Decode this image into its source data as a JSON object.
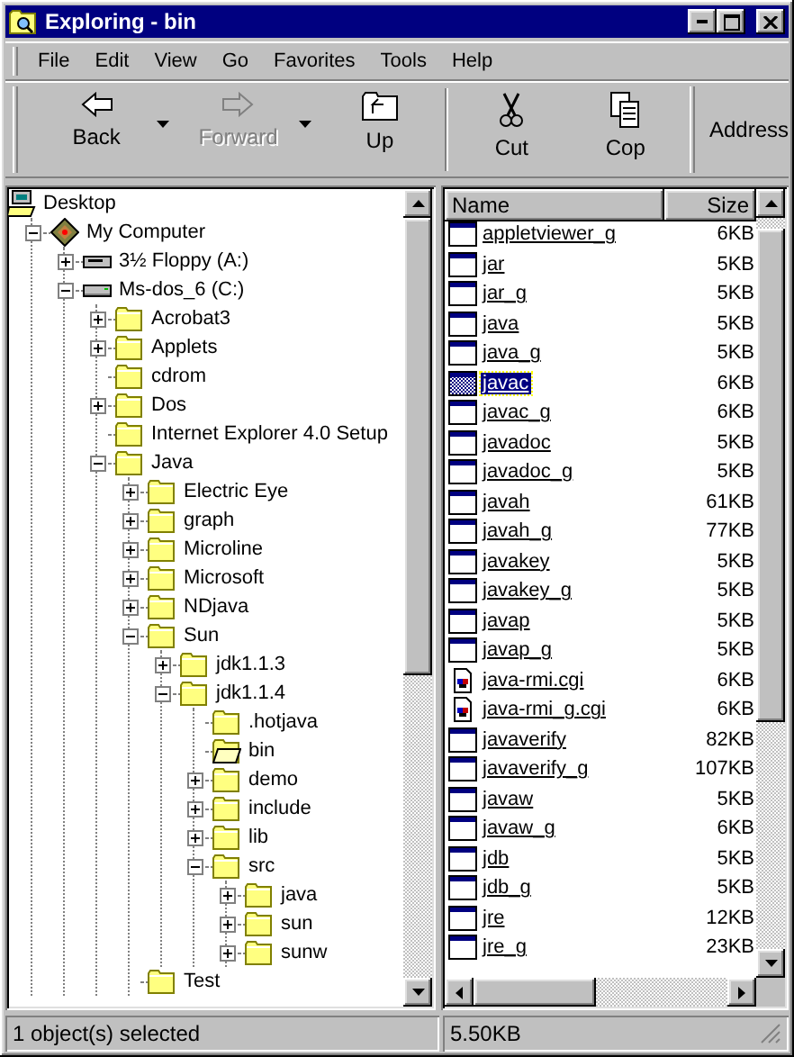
{
  "window": {
    "title": "Exploring - bin"
  },
  "menu": [
    "File",
    "Edit",
    "View",
    "Go",
    "Favorites",
    "Tools",
    "Help"
  ],
  "toolbar": {
    "buttons": [
      {
        "label": "Back",
        "kind": "back",
        "disabled": false,
        "dropdown": true,
        "separator_before": false
      },
      {
        "label": "Forward",
        "kind": "forward",
        "disabled": true,
        "dropdown": true,
        "separator_before": false
      },
      {
        "label": "Up",
        "kind": "up",
        "disabled": false,
        "dropdown": false,
        "separator_before": false
      },
      {
        "label": "Cut",
        "kind": "cut",
        "disabled": false,
        "dropdown": false,
        "separator_before": true
      },
      {
        "label": "Cop",
        "kind": "copy",
        "disabled": false,
        "dropdown": false,
        "separator_before": false
      }
    ],
    "address_label": "Address"
  },
  "folder_tree": {
    "label": "Desktop",
    "kind": "desktop",
    "children": [
      {
        "label": "My Computer",
        "kind": "computer",
        "expanded": true,
        "children": [
          {
            "label": "3½ Floppy (A:)",
            "kind": "floppy",
            "expanded": false
          },
          {
            "label": "Ms-dos_6 (C:)",
            "kind": "drive",
            "expanded": true,
            "children": [
              {
                "label": "Acrobat3",
                "kind": "folder",
                "expanded": false
              },
              {
                "label": "Applets",
                "kind": "folder",
                "expanded": false
              },
              {
                "label": "cdrom",
                "kind": "folder"
              },
              {
                "label": "Dos",
                "kind": "folder",
                "expanded": false
              },
              {
                "label": "Internet Explorer 4.0 Setup",
                "kind": "folder"
              },
              {
                "label": "Java",
                "kind": "folder",
                "expanded": true,
                "children": [
                  {
                    "label": "Electric Eye",
                    "kind": "folder",
                    "expanded": false
                  },
                  {
                    "label": "graph",
                    "kind": "folder",
                    "expanded": false
                  },
                  {
                    "label": "Microline",
                    "kind": "folder",
                    "expanded": false
                  },
                  {
                    "label": "Microsoft",
                    "kind": "folder",
                    "expanded": false
                  },
                  {
                    "label": "NDjava",
                    "kind": "folder",
                    "expanded": false
                  },
                  {
                    "label": "Sun",
                    "kind": "folder",
                    "expanded": true,
                    "children": [
                      {
                        "label": "jdk1.1.3",
                        "kind": "folder",
                        "expanded": false
                      },
                      {
                        "label": "jdk1.1.4",
                        "kind": "folder",
                        "expanded": true,
                        "children": [
                          {
                            "label": ".hotjava",
                            "kind": "folder"
                          },
                          {
                            "label": "bin",
                            "kind": "open-folder"
                          },
                          {
                            "label": "demo",
                            "kind": "folder",
                            "expanded": false
                          },
                          {
                            "label": "include",
                            "kind": "folder",
                            "expanded": false
                          },
                          {
                            "label": "lib",
                            "kind": "folder",
                            "expanded": false
                          },
                          {
                            "label": "src",
                            "kind": "folder",
                            "expanded": true,
                            "children": [
                              {
                                "label": "java",
                                "kind": "folder",
                                "expanded": false
                              },
                              {
                                "label": "sun",
                                "kind": "folder",
                                "expanded": false
                              },
                              {
                                "label": "sunw",
                                "kind": "folder",
                                "expanded": false
                              }
                            ]
                          }
                        ]
                      }
                    ]
                  },
                  {
                    "label": "Test",
                    "kind": "folder"
                  }
                ]
              }
            ]
          }
        ]
      }
    ]
  },
  "file_list": {
    "columns": [
      {
        "label": "Name"
      },
      {
        "label": "Size"
      }
    ],
    "rows": [
      {
        "name": "appletviewer_g",
        "size": "6KB",
        "kind": "app",
        "selected": false
      },
      {
        "name": "jar",
        "size": "5KB",
        "kind": "app",
        "selected": false
      },
      {
        "name": "jar_g",
        "size": "5KB",
        "kind": "app",
        "selected": false
      },
      {
        "name": "java",
        "size": "5KB",
        "kind": "app",
        "selected": false
      },
      {
        "name": "java_g",
        "size": "5KB",
        "kind": "app",
        "selected": false
      },
      {
        "name": "javac",
        "size": "6KB",
        "kind": "app",
        "selected": true
      },
      {
        "name": "javac_g",
        "size": "6KB",
        "kind": "app",
        "selected": false
      },
      {
        "name": "javadoc",
        "size": "5KB",
        "kind": "app",
        "selected": false
      },
      {
        "name": "javadoc_g",
        "size": "5KB",
        "kind": "app",
        "selected": false
      },
      {
        "name": "javah",
        "size": "61KB",
        "kind": "app",
        "selected": false
      },
      {
        "name": "javah_g",
        "size": "77KB",
        "kind": "app",
        "selected": false
      },
      {
        "name": "javakey",
        "size": "5KB",
        "kind": "app",
        "selected": false
      },
      {
        "name": "javakey_g",
        "size": "5KB",
        "kind": "app",
        "selected": false
      },
      {
        "name": "javap",
        "size": "5KB",
        "kind": "app",
        "selected": false
      },
      {
        "name": "javap_g",
        "size": "5KB",
        "kind": "app",
        "selected": false
      },
      {
        "name": "java-rmi.cgi",
        "size": "6KB",
        "kind": "script",
        "selected": false
      },
      {
        "name": "java-rmi_g.cgi",
        "size": "6KB",
        "kind": "script",
        "selected": false
      },
      {
        "name": "javaverify",
        "size": "82KB",
        "kind": "app",
        "selected": false
      },
      {
        "name": "javaverify_g",
        "size": "107KB",
        "kind": "app",
        "selected": false
      },
      {
        "name": "javaw",
        "size": "5KB",
        "kind": "app",
        "selected": false
      },
      {
        "name": "javaw_g",
        "size": "6KB",
        "kind": "app",
        "selected": false
      },
      {
        "name": "jdb",
        "size": "5KB",
        "kind": "app",
        "selected": false
      },
      {
        "name": "jdb_g",
        "size": "5KB",
        "kind": "app",
        "selected": false
      },
      {
        "name": "jre",
        "size": "12KB",
        "kind": "app",
        "selected": false
      },
      {
        "name": "jre_g",
        "size": "23KB",
        "kind": "app",
        "selected": false
      }
    ]
  },
  "status_bar": [
    "1 object(s) selected",
    "5.50KB"
  ]
}
